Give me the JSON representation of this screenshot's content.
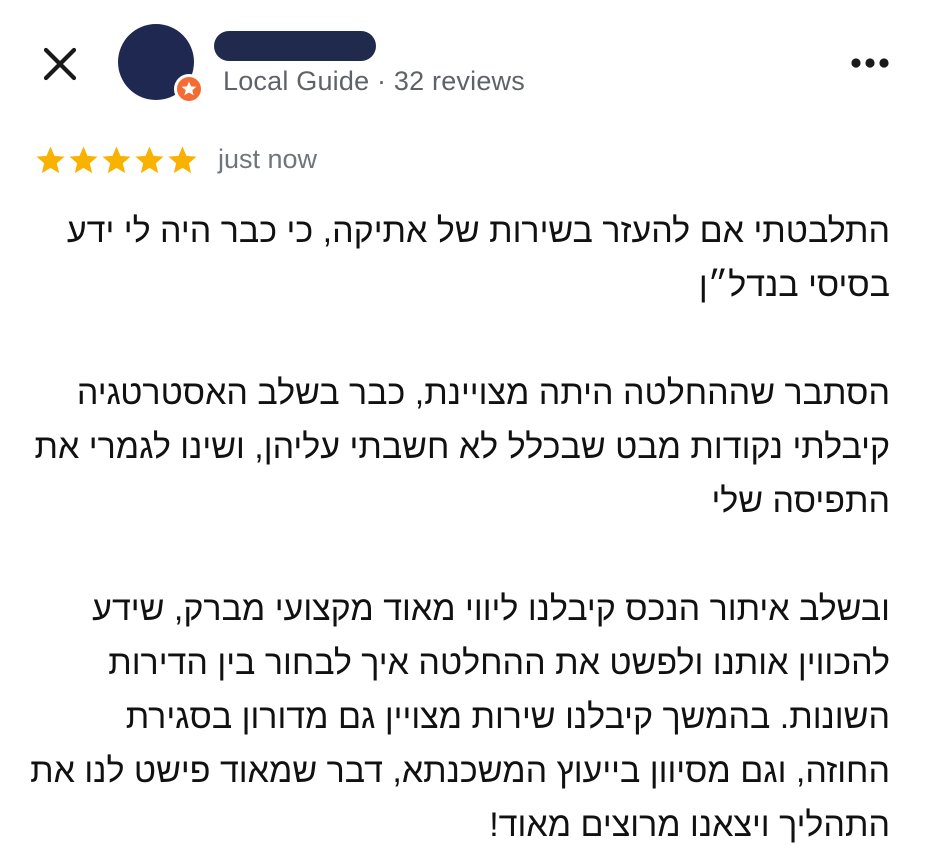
{
  "reviewer": {
    "meta": "Local Guide · 32 reviews"
  },
  "review": {
    "rating": 5,
    "rating_max": 5,
    "time": "just now",
    "paragraphs": [
      "התלבטתי אם להעזר בשירות של אתיקה, כי כבר היה לי ידע בסיסי בנדל״ן",
      "הסתבר שההחלטה היתה מצויינת, כבר בשלב האסטרטגיה קיבלתי נקודות מבט שבכלל לא חשבתי עליהן, ושינו לגמרי את התפיסה שלי",
      "ובשלב איתור הנכס קיבלנו ליווי מאוד מקצועי מברק, שידע להכווין אותנו ולפשט את ההחלטה איך לבחור בין הדירות השונות. בהמשך קיבלנו שירות מצויין גם מדורון בסגירת החוזה, וגם מסיוון בייעוץ המשכנתא, דבר שמאוד פישט לנו את התהליך ויצאנו מרוצים מאוד!"
    ]
  },
  "icons": {
    "close": "close-icon",
    "more": "more-horizontal-icon",
    "star": "star-icon",
    "guide_badge": "local-guide-star-icon"
  },
  "colors": {
    "star": "#f9b200",
    "guide_badge": "#f46b33",
    "redaction": "#1f2a4d",
    "secondary_text": "#5f6368"
  }
}
